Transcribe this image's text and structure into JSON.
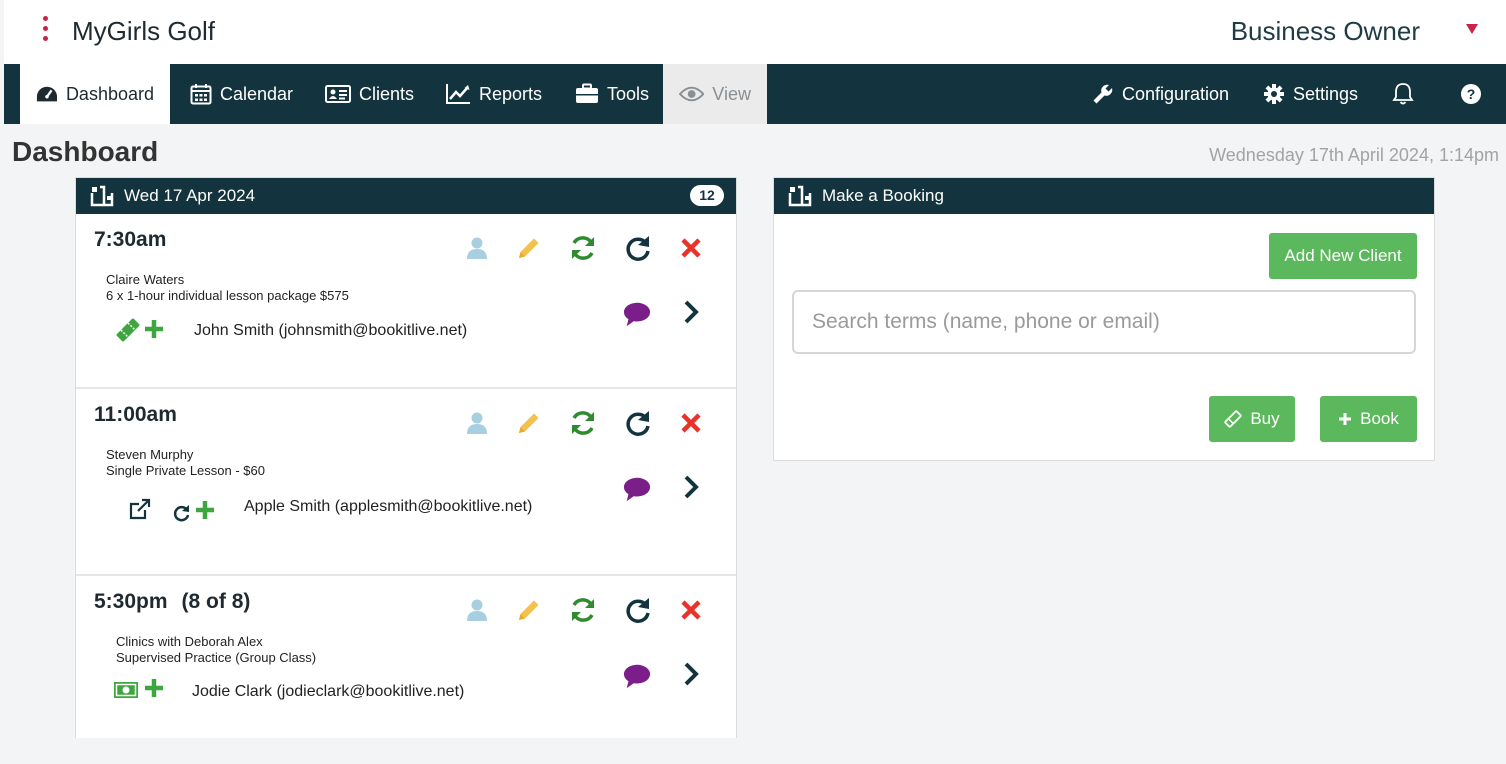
{
  "header": {
    "app_title": "MyGirls Golf",
    "role": "Business Owner"
  },
  "nav": {
    "dashboard": "Dashboard",
    "calendar": "Calendar",
    "clients": "Clients",
    "reports": "Reports",
    "tools": "Tools",
    "view": "View",
    "configuration": "Configuration",
    "settings": "Settings"
  },
  "page": {
    "title": "Dashboard",
    "datetime": "Wednesday 17th April 2024, 1:14pm"
  },
  "day_panel": {
    "date": "Wed 17 Apr 2024",
    "count": "12",
    "appointments": [
      {
        "time": "7:30am",
        "capacity": "",
        "client": "Claire Waters",
        "service": "6 x 1-hour individual lesson package $575",
        "guest": "John Smith (johnsmith@bookitlive.net)"
      },
      {
        "time": "11:00am",
        "capacity": "",
        "client": "Steven Murphy",
        "service": "Single Private Lesson - $60",
        "guest": "Apple Smith (applesmith@bookitlive.net)"
      },
      {
        "time": "5:30pm",
        "capacity": "(8 of 8)",
        "client": "Clinics with Deborah Alex",
        "service": "Supervised Practice (Group Class)",
        "guest": "Jodie Clark (jodieclark@bookitlive.net)"
      }
    ]
  },
  "booking_panel": {
    "title": "Make a Booking",
    "add_client_label": "Add New Client",
    "search_placeholder": "Search terms (name, phone or email)",
    "buy_label": "Buy",
    "book_label": "Book"
  },
  "colors": {
    "nav_bg": "#13343e",
    "accent_green": "#5cb85c",
    "brand_red": "#c8234a",
    "chat_purple": "#7b1e8a",
    "delete_red": "#e8322a",
    "edit_yellow": "#f2c14e",
    "person_blue": "#a8cfe0",
    "refresh_green": "#2e8b2e"
  },
  "icons": {
    "appointment_actions": [
      "user-icon",
      "pencil-icon",
      "sync-icon",
      "redo-icon",
      "delete-icon",
      "chat-icon",
      "chevron-right-icon"
    ]
  }
}
